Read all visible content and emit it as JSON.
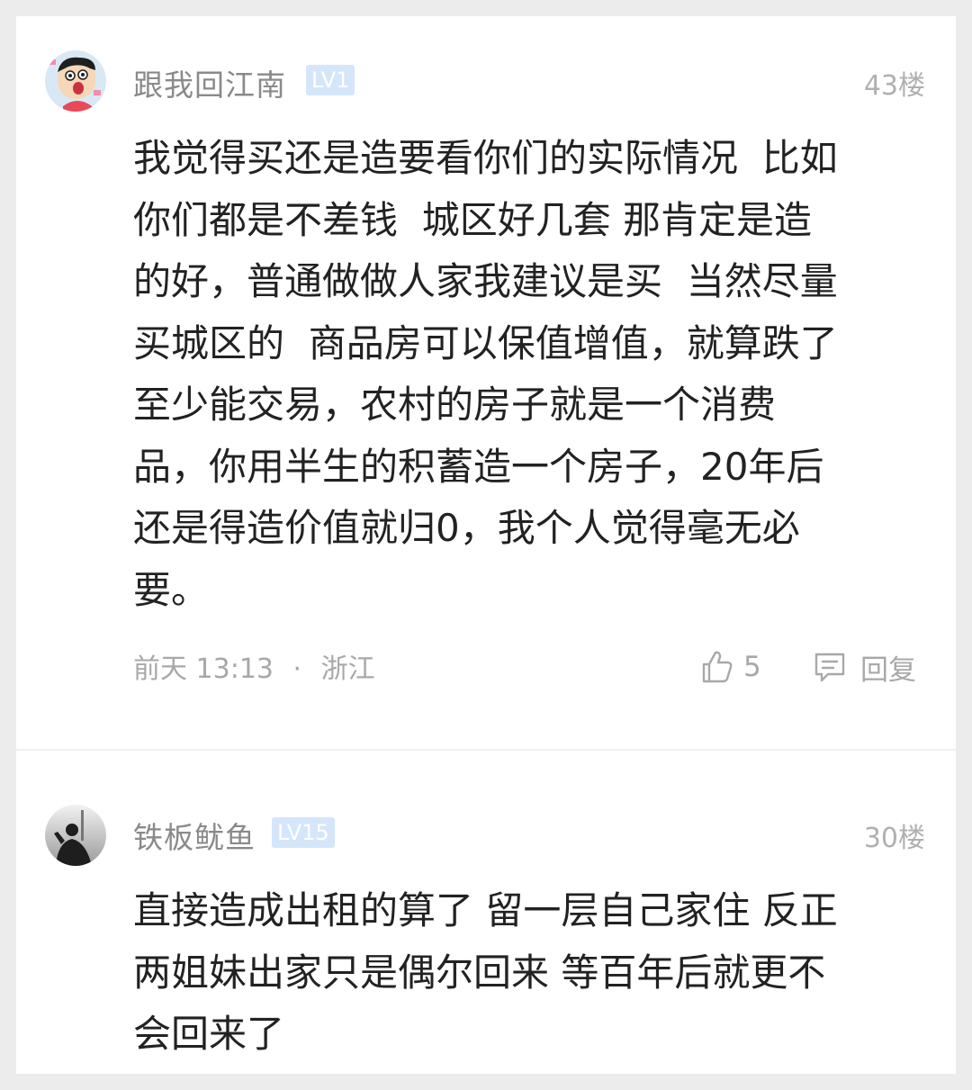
{
  "comments": [
    {
      "username": "跟我回江南",
      "level": "LV1",
      "floor": "43楼",
      "avatar_icon": "cartoon-boy-avatar",
      "content": "我觉得买还是造要看你们的实际情况  比如\n你们都是不差钱  城区好几套 那肯定是造\n的好，普通做做人家我建议是买  当然尽量\n买城区的  商品房可以保值增值，就算跌了\n至少能交易，农村的房子就是一个消费\n品，你用半生的积蓄造一个房子，20年后\n还是得造价值就归0，我个人觉得毫无必\n要。",
      "time": "前天 13:13",
      "location": "浙江",
      "meta_separator": "·",
      "likes": "5",
      "reply_label": "回复"
    },
    {
      "username": "铁板鱿鱼",
      "level": "LV15",
      "floor": "30楼",
      "avatar_icon": "silhouette-avatar",
      "content": "直接造成出租的算了 留一层自己家住 反正\n两姐妹出家只是偶尔回来 等百年后就更不\n会回来了"
    }
  ],
  "colors": {
    "username": "#8a8a8a",
    "level_badge_bg": "#d5e6fb",
    "content_text": "#222222",
    "meta_text": "#a8a8a8",
    "page_bg": "#ececec"
  }
}
